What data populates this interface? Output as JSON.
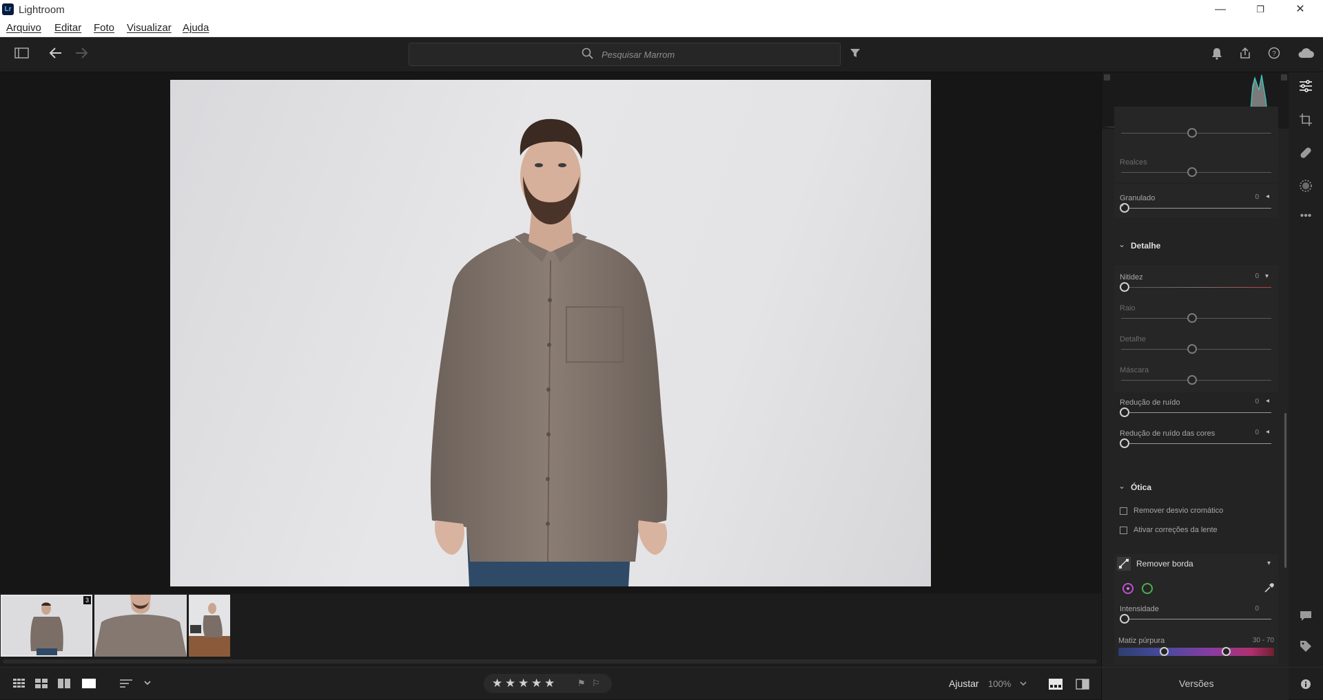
{
  "window": {
    "title": "Lightroom",
    "logo_text": "Lr",
    "minimize": "—",
    "restore": "❐",
    "close": "✕"
  },
  "menu": [
    "Arquivo",
    "Editar",
    "Foto",
    "Visualizar",
    "Ajuda"
  ],
  "toolbar": {
    "search_placeholder": "Pesquisar Marrom"
  },
  "filmstrip": {
    "stack_count": "3"
  },
  "panel": {
    "effects": {
      "realces_label": "Realces",
      "granulado_label": "Granulado",
      "granulado_value": "0"
    },
    "detalhe": {
      "title": "Detalhe",
      "nitidez_label": "Nitidez",
      "nitidez_value": "0",
      "raio_label": "Raio",
      "detalhe_label": "Detalhe",
      "mascara_label": "Máscara",
      "reducao_ruido_label": "Redução de ruído",
      "reducao_ruido_value": "0",
      "reducao_ruido_cores_label": "Redução de ruído das cores",
      "reducao_ruido_cores_value": "0"
    },
    "otica": {
      "title": "Ótica",
      "remover_desvio": "Remover desvio cromático",
      "ativar_correcoes": "Ativar correções da lente",
      "remover_borda_title": "Remover borda",
      "intensidade_label": "Intensidade",
      "intensidade_value": "0",
      "matiz_purpura_label": "Matiz púrpura",
      "matiz_purpura_value": "30 - 70"
    }
  },
  "bottom": {
    "ajustar_label": "Ajustar",
    "zoom_value": "100%",
    "versions_label": "Versões",
    "rating_stars": 5
  }
}
